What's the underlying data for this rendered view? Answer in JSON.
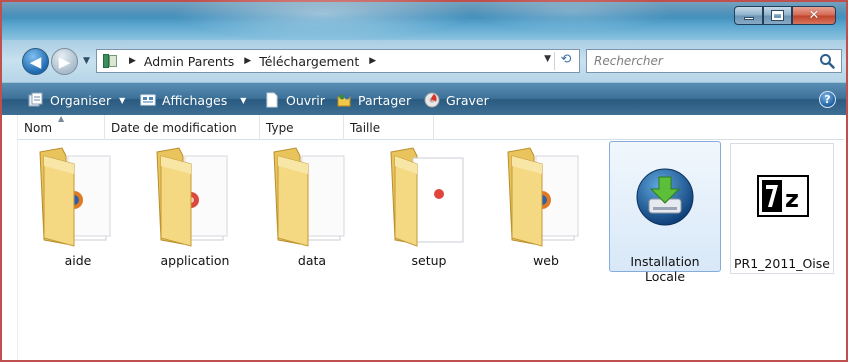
{
  "window": {
    "controls": {
      "minimize_icon": "minimize-icon",
      "maximize_icon": "maximize-icon",
      "close_icon": "close-icon"
    }
  },
  "navigation": {
    "breadcrumb": [
      "Admin Parents",
      "Téléchargement"
    ],
    "search_placeholder": "Rechercher"
  },
  "toolbar": {
    "organize": "Organiser",
    "views": "Affichages",
    "open": "Ouvrir",
    "share": "Partager",
    "burn": "Graver",
    "help": "?"
  },
  "columns": [
    "Nom",
    "Date de modification",
    "Type",
    "Taille"
  ],
  "items": [
    {
      "name": "aide",
      "kind": "folder",
      "badge": "firefox"
    },
    {
      "name": "application",
      "kind": "folder",
      "badge": "firefox-red"
    },
    {
      "name": "data",
      "kind": "folder",
      "badge": "none"
    },
    {
      "name": "setup",
      "kind": "folder",
      "badge": "red-dot"
    },
    {
      "name": "web",
      "kind": "folder",
      "badge": "firefox"
    },
    {
      "name": "Installation Locale",
      "kind": "installer",
      "selected": true
    },
    {
      "name": "PR1_2011_Oise",
      "kind": "7z-archive"
    }
  ],
  "colors": {
    "accent": "#3d7199",
    "selection": "#d8e8f8",
    "folder": "#f2d27a"
  }
}
